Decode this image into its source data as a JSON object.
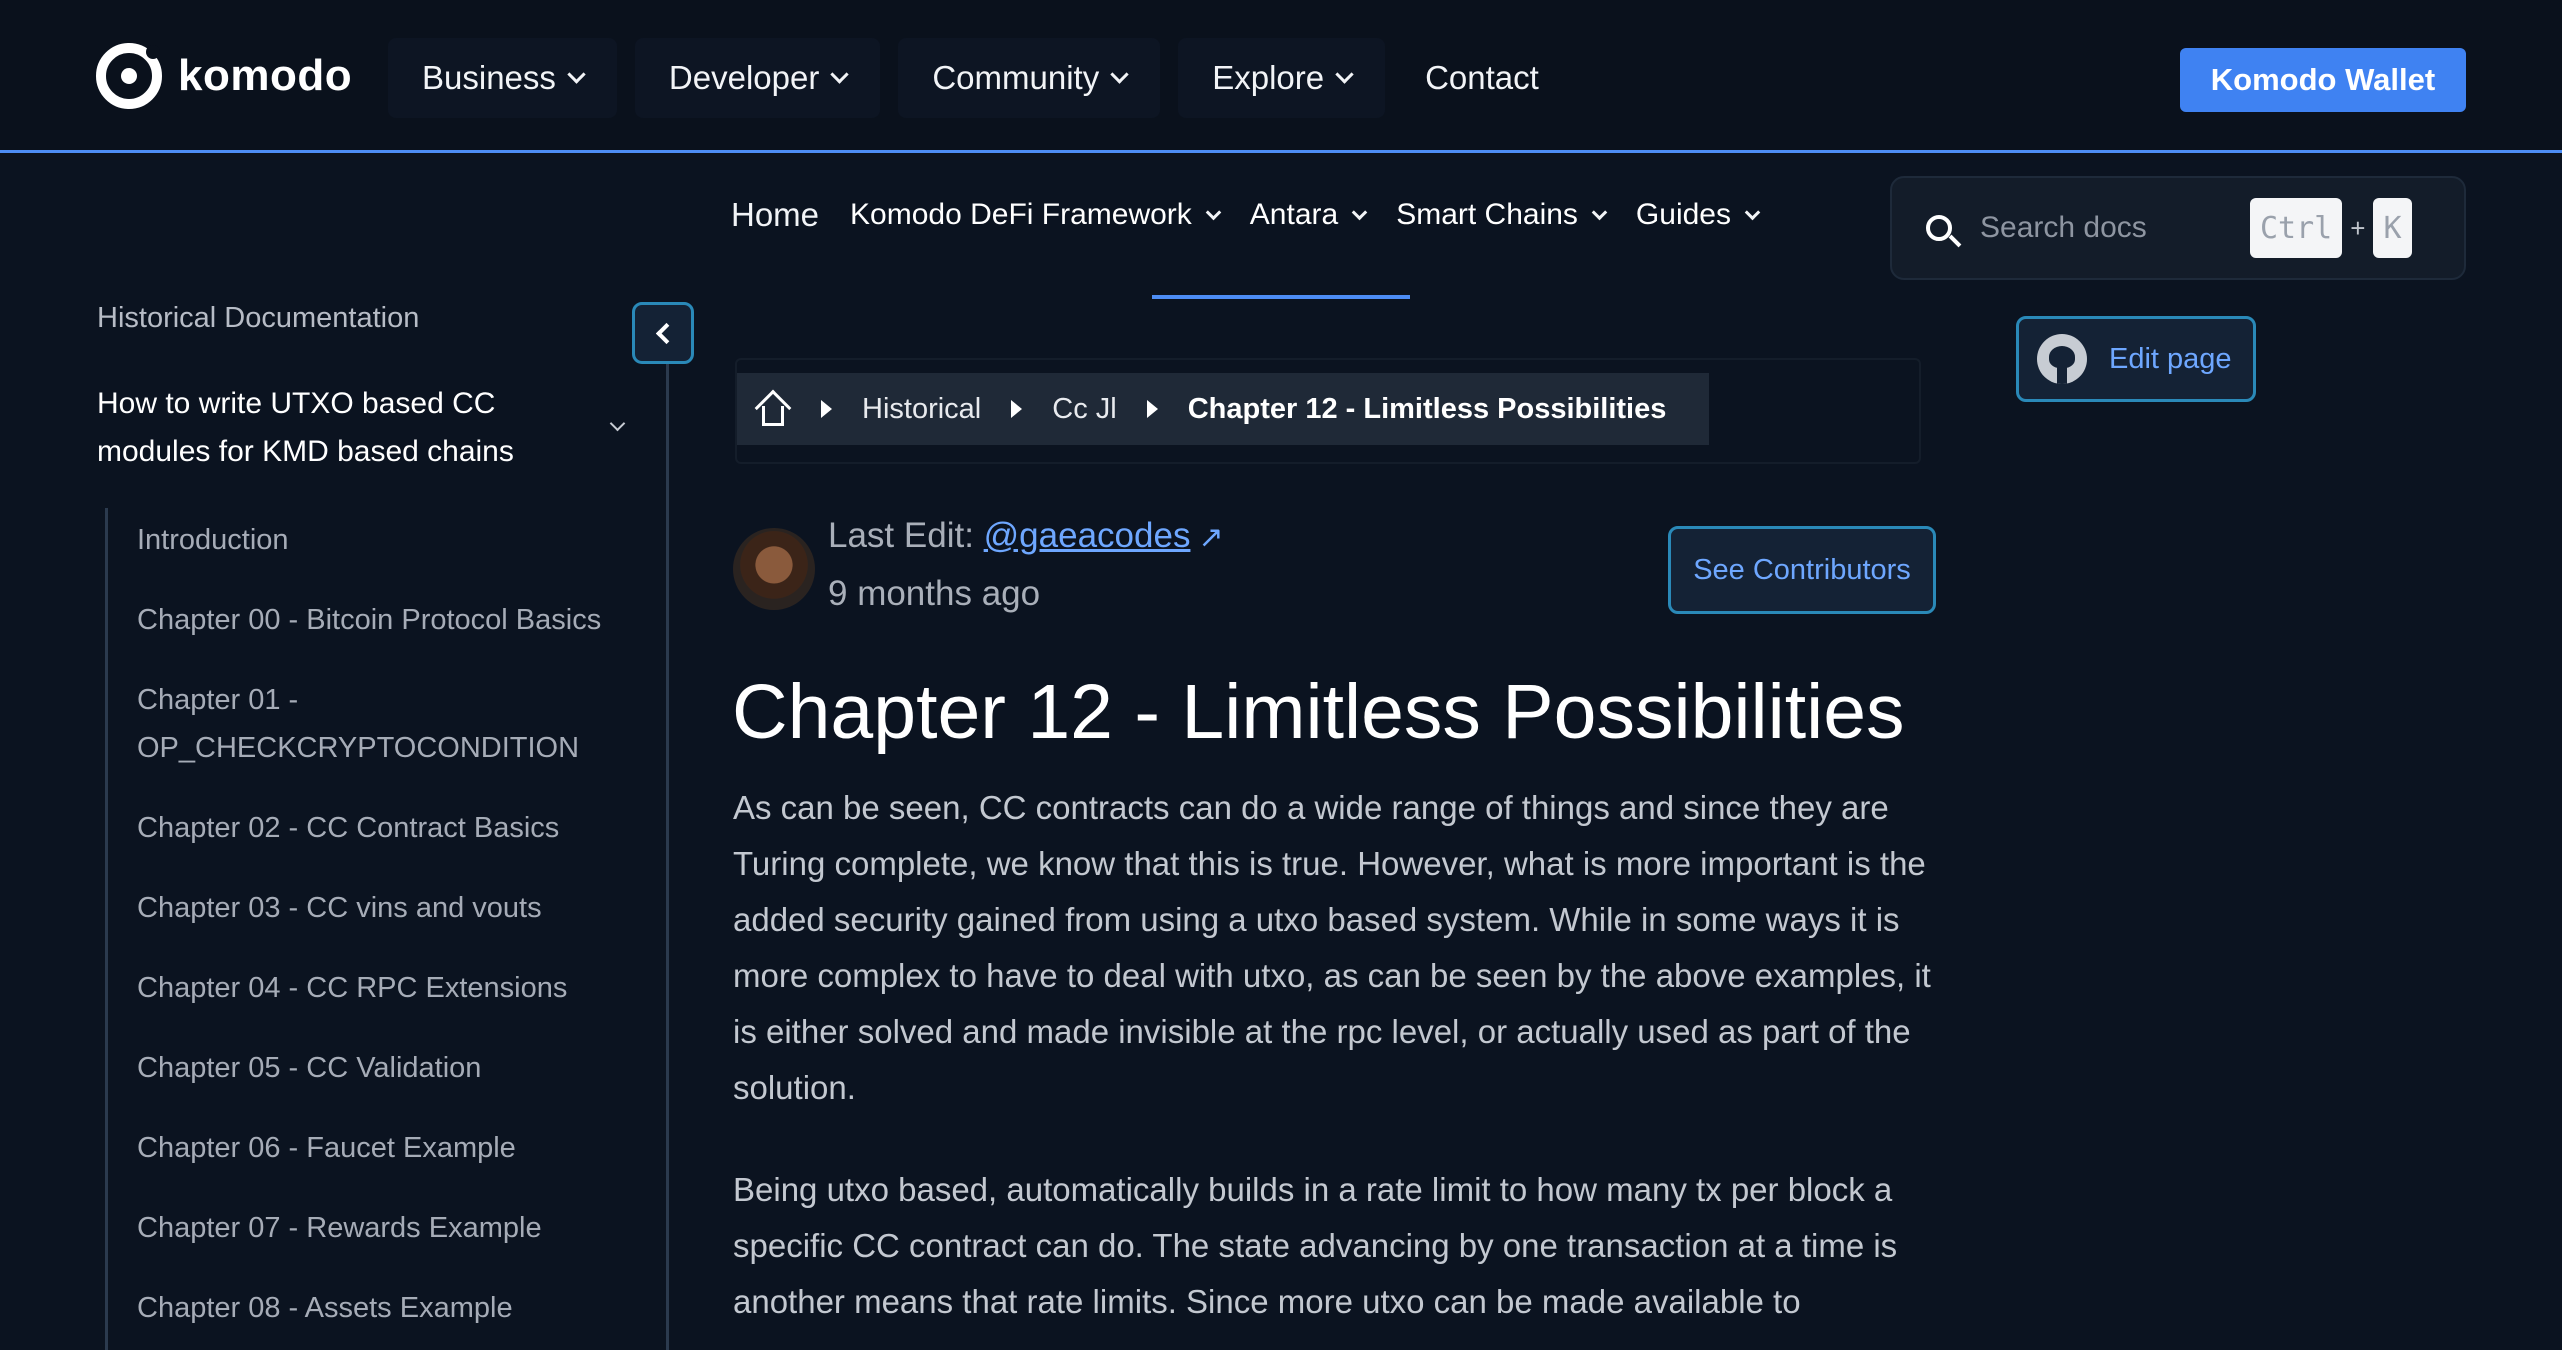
{
  "header": {
    "logo_text": "komodo",
    "nav": [
      {
        "label": "Business"
      },
      {
        "label": "Developer"
      },
      {
        "label": "Community"
      },
      {
        "label": "Explore"
      },
      {
        "label": "Contact"
      }
    ],
    "wallet_button": "Komodo Wallet"
  },
  "docs_nav": {
    "home": "Home",
    "items": [
      {
        "label": "Komodo DeFi Framework"
      },
      {
        "label": "Antara"
      },
      {
        "label": "Smart Chains"
      },
      {
        "label": "Guides"
      }
    ],
    "search_placeholder": "Search docs",
    "shortcut": {
      "key1": "Ctrl",
      "plus": "+",
      "key2": "K"
    },
    "edit_page": "Edit page"
  },
  "sidebar": {
    "title": "Historical Documentation",
    "group_title": "How to write UTXO based CC modules for KMD based chains",
    "items": [
      "Introduction",
      "Chapter 00 - Bitcoin Protocol Basics",
      "Chapter 01 - OP_CHECKCRYPTOCONDITION",
      "Chapter 02 - CC Contract Basics",
      "Chapter 03 - CC vins and vouts",
      "Chapter 04 - CC RPC Extensions",
      "Chapter 05 - CC Validation",
      "Chapter 06 - Faucet Example",
      "Chapter 07 - Rewards Example",
      "Chapter 08 - Assets Example"
    ]
  },
  "breadcrumb": {
    "items": [
      "Historical",
      "Cc Jl"
    ],
    "current": "Chapter 12 - Limitless Possibilities"
  },
  "meta": {
    "last_edit_label": "Last Edit:",
    "user": "@gaeacodes",
    "arrow": "↗",
    "time": "9 months ago",
    "contributors_button": "See Contributors"
  },
  "content": {
    "title": "Chapter 12 - Limitless Possibilities",
    "paragraph1": "As can be seen, CC contracts can do a wide range of things and since they are Turing complete, we know that this is true. However, what is more important is the added security gained from using a utxo based system. While in some ways it is more complex to have to deal with utxo, as can be seen by the above examples, it is either solved and made invisible at the rpc level, or actually used as part of the solution.",
    "paragraph2": "Being utxo based, automatically builds in a rate limit to how many tx per block a specific CC contract can do. The state advancing by one transaction at a time is another means that rate limits. Since more utxo can be made available to"
  }
}
